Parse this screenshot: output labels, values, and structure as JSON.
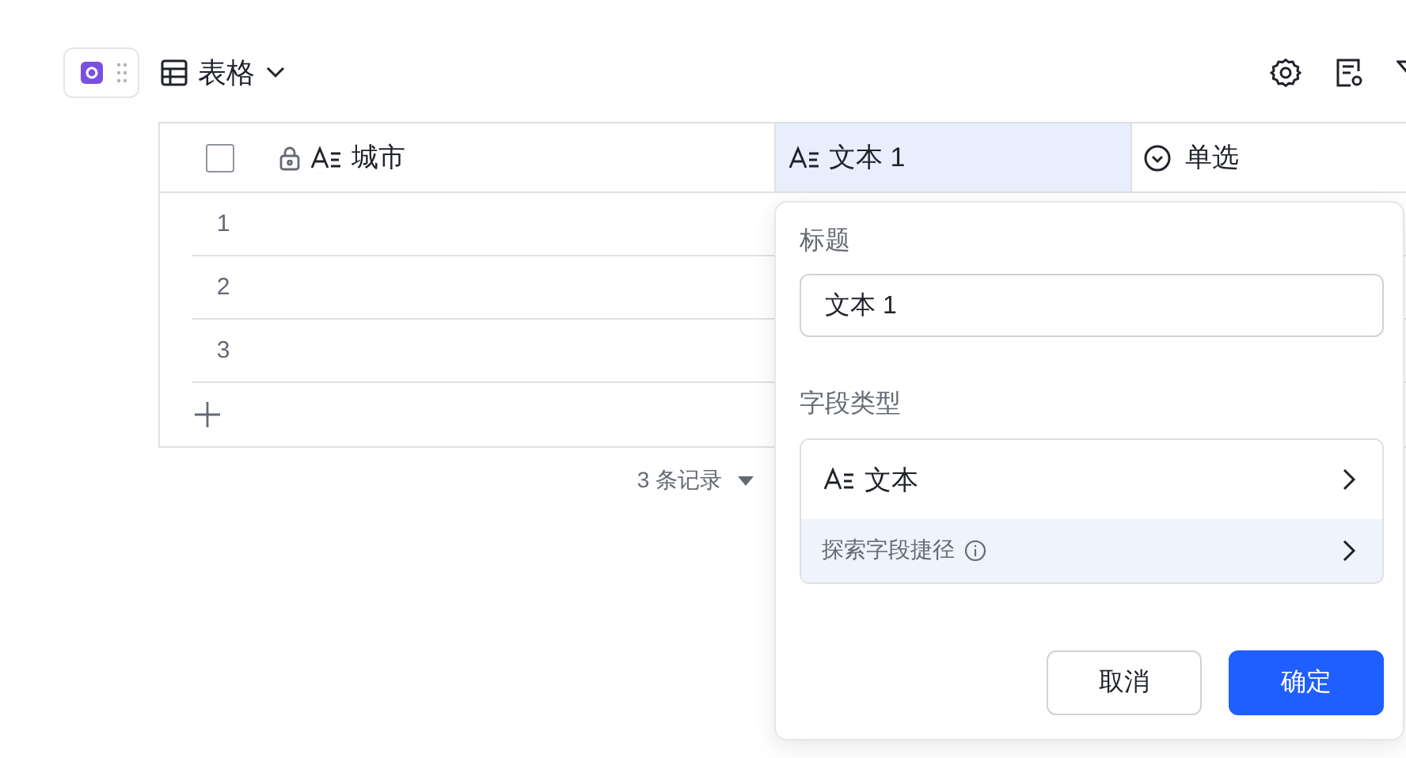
{
  "toolbar": {
    "view_label": "表格"
  },
  "table": {
    "header_checked": false,
    "columns": [
      {
        "label": "城市",
        "kind": "text",
        "locked": true,
        "selected": false
      },
      {
        "label": "文本 1",
        "kind": "text",
        "locked": false,
        "selected": true
      },
      {
        "label": "单选",
        "kind": "single_select",
        "locked": false,
        "selected": false
      }
    ],
    "rows": [
      {
        "index": "1"
      },
      {
        "index": "2"
      },
      {
        "index": "3"
      }
    ],
    "record_count": "3 条记录"
  },
  "popup": {
    "title_label": "标题",
    "title_value": "文本 1",
    "type_label": "字段类型",
    "type_value": "文本",
    "shortcut_label": "探索字段捷径",
    "buttons": [
      {
        "label": "取消",
        "kind": "secondary"
      },
      {
        "label": "确定",
        "kind": "primary"
      }
    ]
  }
}
